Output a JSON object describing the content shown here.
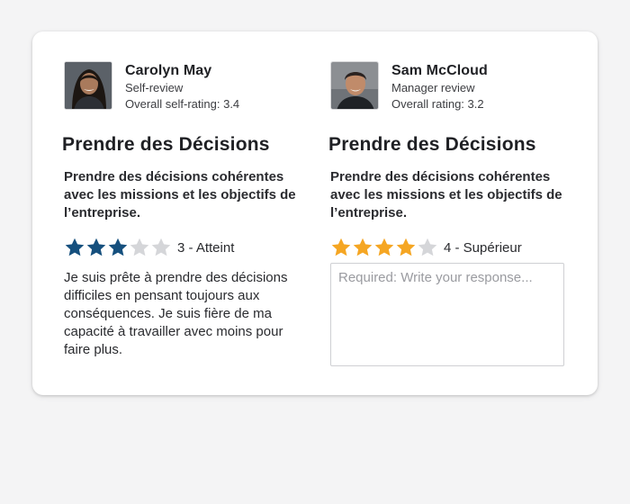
{
  "colors": {
    "self_star": "#16507e",
    "manager_star": "#f5a623",
    "empty_star": "#d5d6d9"
  },
  "self_review": {
    "reviewer_name": "Carolyn May",
    "review_type": "Self-review",
    "overall_rating": "Overall self-rating: 3.4",
    "competency_title": "Prendre des Décisions",
    "competency_description": "Prendre des décisions cohérentes avec les missions et les objectifs de l’entreprise.",
    "stars_filled": 3,
    "stars_total": 5,
    "rating_label": "3 - Atteint",
    "comment": "Je suis prête à prendre des décisions difficiles en pensant toujours aux conséquences. Je suis fière de ma capacité à travailler avec moins pour faire plus."
  },
  "manager_review": {
    "reviewer_name": "Sam McCloud",
    "review_type": "Manager review",
    "overall_rating": "Overall rating: 3.2",
    "competency_title": "Prendre des Décisions",
    "competency_description": "Prendre des décisions cohérentes avec les missions et les objectifs de l’entreprise.",
    "stars_filled": 4,
    "stars_total": 5,
    "rating_label": "4 - Supérieur",
    "response_placeholder": "Required: Write your response..."
  }
}
